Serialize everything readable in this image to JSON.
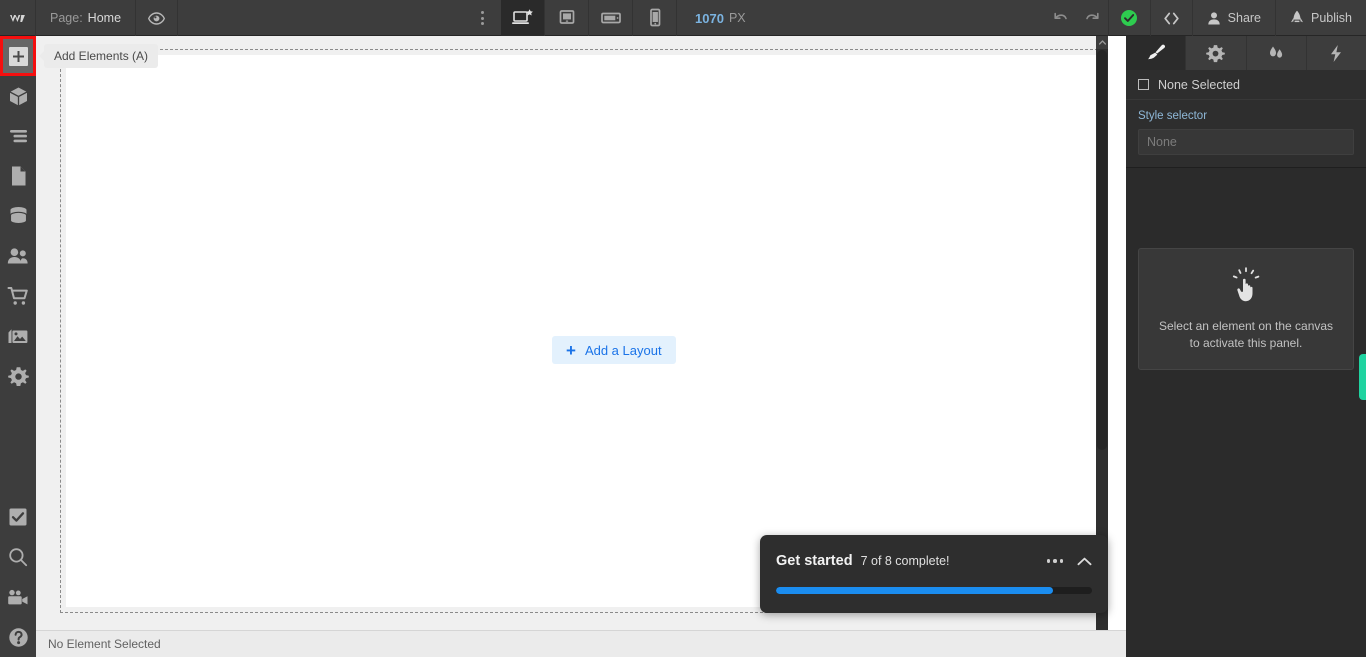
{
  "toolbar": {
    "logo": "W",
    "page_label": "Page:",
    "page_name": "Home",
    "preview_icon": "eye-icon",
    "menu_icon": "vertical-dots-icon",
    "breakpoints": [
      {
        "name": "desktop",
        "icon": "desktop-star-icon",
        "active": true
      },
      {
        "name": "tablet",
        "icon": "tablet-icon",
        "active": false
      },
      {
        "name": "mobile-landscape",
        "icon": "mobile-landscape-icon",
        "active": false
      },
      {
        "name": "mobile-portrait",
        "icon": "mobile-portrait-icon",
        "active": false
      }
    ],
    "canvas_width": "1070",
    "canvas_unit": "PX",
    "undo_icon": "undo-icon",
    "redo_icon": "redo-icon",
    "save_status_icon": "check-circle-icon",
    "save_status_color": "#2ecc4f",
    "code_icon": "code-brackets-icon",
    "share_label": "Share",
    "share_icon": "person-icon",
    "publish_label": "Publish",
    "publish_icon": "rocket-icon"
  },
  "sidebar": {
    "items": [
      {
        "name": "add-elements",
        "icon": "plus-icon",
        "active": true,
        "highlighted": true
      },
      {
        "name": "components",
        "icon": "cube-icon",
        "active": false,
        "highlighted": false
      },
      {
        "name": "navigator",
        "icon": "navigator-lines-icon",
        "active": false,
        "highlighted": false
      },
      {
        "name": "pages",
        "icon": "page-icon",
        "active": false,
        "highlighted": false
      },
      {
        "name": "cms",
        "icon": "database-icon",
        "active": false,
        "highlighted": false
      },
      {
        "name": "users",
        "icon": "users-icon",
        "active": false,
        "highlighted": false
      },
      {
        "name": "ecommerce",
        "icon": "shopping-cart-icon",
        "active": false,
        "highlighted": false
      },
      {
        "name": "assets",
        "icon": "images-icon",
        "active": false,
        "highlighted": false
      },
      {
        "name": "settings",
        "icon": "gear-icon",
        "active": false,
        "highlighted": false
      }
    ],
    "bottom_items": [
      {
        "name": "audit",
        "icon": "checkbox-check-icon"
      },
      {
        "name": "search",
        "icon": "magnifier-icon"
      },
      {
        "name": "video-tutorials",
        "icon": "video-camera-icon"
      },
      {
        "name": "help",
        "icon": "question-circle-icon"
      }
    ]
  },
  "tooltip": {
    "text": "Add Elements (A)"
  },
  "canvas": {
    "add_layout_label": "Add a Layout",
    "add_layout_plus": "+"
  },
  "get_started": {
    "title": "Get started",
    "subtitle": "7 of 8 complete!",
    "more_icon": "horizontal-dots-icon",
    "collapse_icon": "chevron-up-icon",
    "progress_percent": 87.5,
    "progress_color": "#1b8df0"
  },
  "right_panel": {
    "tabs": [
      {
        "name": "style",
        "icon": "paintbrush-icon",
        "active": true
      },
      {
        "name": "settings",
        "icon": "gear-icon",
        "active": false
      },
      {
        "name": "style-manager",
        "icon": "droplets-icon",
        "active": false
      },
      {
        "name": "interactions",
        "icon": "lightning-bolt-icon",
        "active": false
      }
    ],
    "selected_label": "None Selected",
    "style_selector_label": "Style selector",
    "style_selector_value": "",
    "style_selector_placeholder": "None",
    "empty_icon": "pointing-hand-click-icon",
    "empty_text": "Select an element on the canvas to activate this panel.",
    "feedback_tab_color": "#1fd3a0"
  },
  "status_bar": {
    "text": "No Element Selected"
  }
}
